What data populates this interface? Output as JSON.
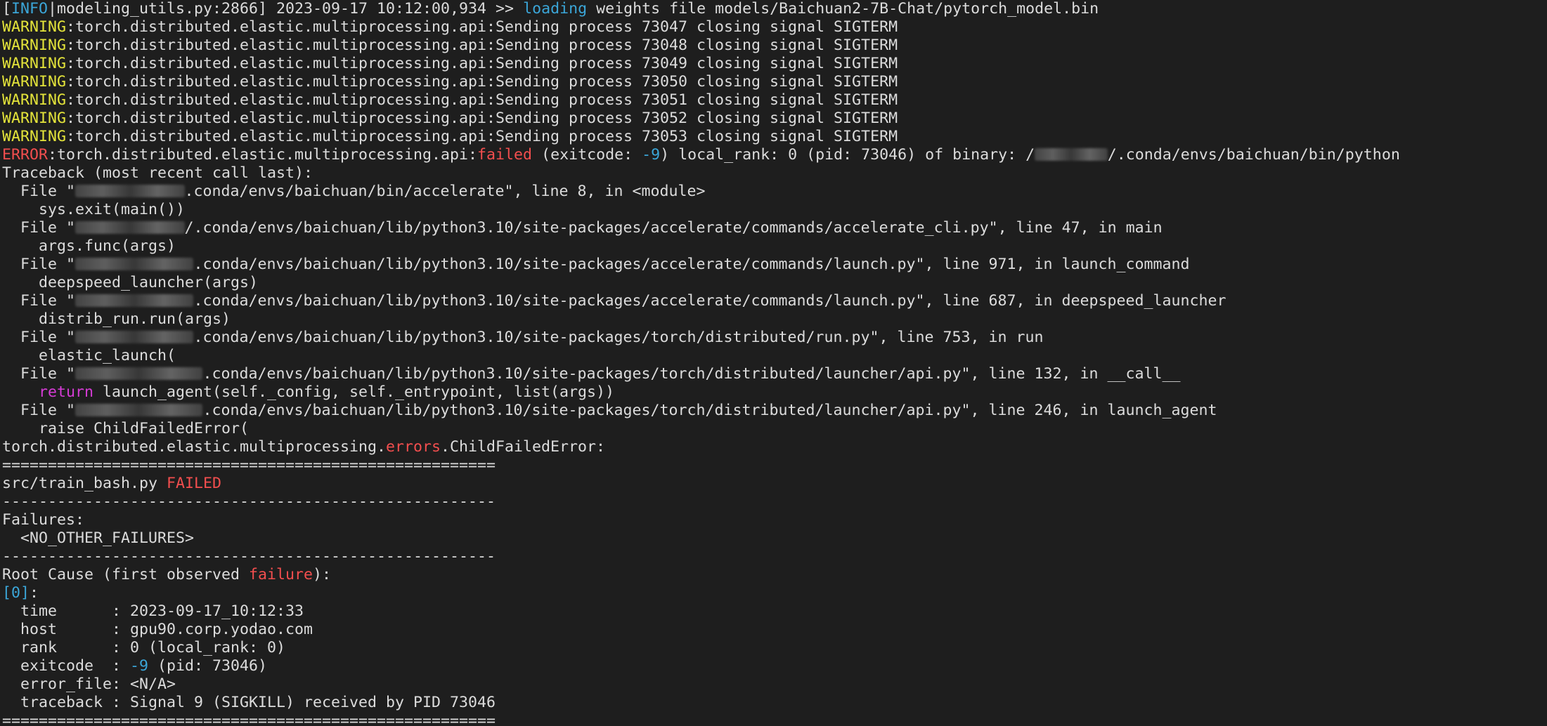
{
  "colors": {
    "background": "#1e1e1e",
    "text": "#dcdcdc",
    "cyan": "#3ba6d8",
    "yellow": "#e3e33a",
    "red": "#f24e4e",
    "magenta": "#d63cd6"
  },
  "terminal_lines": [
    [
      {
        "c": "white",
        "t": "["
      },
      {
        "c": "cyan",
        "t": "INFO"
      },
      {
        "c": "white",
        "t": "|modeling_utils.py:2866] 2023-09-17 10:12:00,934 >> "
      },
      {
        "c": "cyan",
        "t": "loading"
      },
      {
        "c": "white",
        "t": " weights file models/Baichuan2-7B-Chat/pytorch_model.bin"
      }
    ],
    [
      {
        "c": "yellow",
        "t": "WARNING"
      },
      {
        "c": "white",
        "t": ":torch.distributed.elastic.multiprocessing.api:Sending process 73047 closing signal SIGTERM"
      }
    ],
    [
      {
        "c": "yellow",
        "t": "WARNING"
      },
      {
        "c": "white",
        "t": ":torch.distributed.elastic.multiprocessing.api:Sending process 73048 closing signal SIGTERM"
      }
    ],
    [
      {
        "c": "yellow",
        "t": "WARNING"
      },
      {
        "c": "white",
        "t": ":torch.distributed.elastic.multiprocessing.api:Sending process 73049 closing signal SIGTERM"
      }
    ],
    [
      {
        "c": "yellow",
        "t": "WARNING"
      },
      {
        "c": "white",
        "t": ":torch.distributed.elastic.multiprocessing.api:Sending process 73050 closing signal SIGTERM"
      }
    ],
    [
      {
        "c": "yellow",
        "t": "WARNING"
      },
      {
        "c": "white",
        "t": ":torch.distributed.elastic.multiprocessing.api:Sending process 73051 closing signal SIGTERM"
      }
    ],
    [
      {
        "c": "yellow",
        "t": "WARNING"
      },
      {
        "c": "white",
        "t": ":torch.distributed.elastic.multiprocessing.api:Sending process 73052 closing signal SIGTERM"
      }
    ],
    [
      {
        "c": "yellow",
        "t": "WARNING"
      },
      {
        "c": "white",
        "t": ":torch.distributed.elastic.multiprocessing.api:Sending process 73053 closing signal SIGTERM"
      }
    ],
    [
      {
        "c": "red",
        "t": "ERROR"
      },
      {
        "c": "white",
        "t": ":torch.distributed.elastic.multiprocessing.api:"
      },
      {
        "c": "red",
        "t": "failed"
      },
      {
        "c": "white",
        "t": " (exitcode: "
      },
      {
        "c": "cyan",
        "t": "-9"
      },
      {
        "c": "white",
        "t": ") local_rank: 0 (pid: 73046) of binary: /"
      },
      {
        "c": "blur",
        "w": 8
      },
      {
        "c": "white",
        "t": "/.conda/envs/baichuan/bin/python"
      }
    ],
    [
      {
        "c": "white",
        "t": "Traceback (most recent call last):"
      }
    ],
    [
      {
        "c": "white",
        "t": "  File \""
      },
      {
        "c": "blur",
        "w": 12
      },
      {
        "c": "white",
        "t": ".conda/envs/baichuan/bin/accelerate\", line 8, in <module>"
      }
    ],
    [
      {
        "c": "white",
        "t": "    sys.exit(main())"
      }
    ],
    [
      {
        "c": "white",
        "t": "  File \""
      },
      {
        "c": "blur",
        "w": 12
      },
      {
        "c": "white",
        "t": "/.conda/envs/baichuan/lib/python3.10/site-packages/accelerate/commands/accelerate_cli.py\", line 47, in main"
      }
    ],
    [
      {
        "c": "white",
        "t": "    args.func(args)"
      }
    ],
    [
      {
        "c": "white",
        "t": "  File \""
      },
      {
        "c": "blur",
        "w": 13
      },
      {
        "c": "white",
        "t": ".conda/envs/baichuan/lib/python3.10/site-packages/accelerate/commands/launch.py\", line 971, in launch_command"
      }
    ],
    [
      {
        "c": "white",
        "t": "    deepspeed_launcher(args)"
      }
    ],
    [
      {
        "c": "white",
        "t": "  File \""
      },
      {
        "c": "blur",
        "w": 13
      },
      {
        "c": "white",
        "t": ".conda/envs/baichuan/lib/python3.10/site-packages/accelerate/commands/launch.py\", line 687, in deepspeed_launcher"
      }
    ],
    [
      {
        "c": "white",
        "t": "    distrib_run.run(args)"
      }
    ],
    [
      {
        "c": "white",
        "t": "  File \""
      },
      {
        "c": "blur",
        "w": 13
      },
      {
        "c": "white",
        "t": ".conda/envs/baichuan/lib/python3.10/site-packages/torch/distributed/run.py\", line 753, in run"
      }
    ],
    [
      {
        "c": "white",
        "t": "    elastic_launch("
      }
    ],
    [
      {
        "c": "white",
        "t": "  File \""
      },
      {
        "c": "blur",
        "w": 14
      },
      {
        "c": "white",
        "t": ".conda/envs/baichuan/lib/python3.10/site-packages/torch/distributed/launcher/api.py\", line 132, in __call__"
      }
    ],
    [
      {
        "c": "white",
        "t": "    "
      },
      {
        "c": "magenta",
        "t": "return"
      },
      {
        "c": "white",
        "t": " launch_agent(self._config, self._entrypoint, list(args))"
      }
    ],
    [
      {
        "c": "white",
        "t": "  File \""
      },
      {
        "c": "blur",
        "w": 14
      },
      {
        "c": "white",
        "t": ".conda/envs/baichuan/lib/python3.10/site-packages/torch/distributed/launcher/api.py\", line 246, in launch_agent"
      }
    ],
    [
      {
        "c": "white",
        "t": "    raise ChildFailedError("
      }
    ],
    [
      {
        "c": "white",
        "t": "torch.distributed.elastic.multiprocessing."
      },
      {
        "c": "red",
        "t": "errors"
      },
      {
        "c": "white",
        "t": ".ChildFailedError:"
      }
    ],
    [
      {
        "c": "white",
        "t": "======================================================"
      }
    ],
    [
      {
        "c": "white",
        "t": "src/train_bash.py "
      },
      {
        "c": "red",
        "t": "FAILED"
      }
    ],
    [
      {
        "c": "white",
        "t": "------------------------------------------------------"
      }
    ],
    [
      {
        "c": "white",
        "t": "Failures:"
      }
    ],
    [
      {
        "c": "white",
        "t": "  <NO_OTHER_FAILURES>"
      }
    ],
    [
      {
        "c": "white",
        "t": "------------------------------------------------------"
      }
    ],
    [
      {
        "c": "white",
        "t": "Root Cause (first observed "
      },
      {
        "c": "red",
        "t": "failure"
      },
      {
        "c": "white",
        "t": "):"
      }
    ],
    [
      {
        "c": "cyan",
        "t": "[0]"
      },
      {
        "c": "white",
        "t": ":"
      }
    ],
    [
      {
        "c": "white",
        "t": "  time      : 2023-09-17_10:12:33"
      }
    ],
    [
      {
        "c": "white",
        "t": "  host      : gpu90.corp.yodao.com"
      }
    ],
    [
      {
        "c": "white",
        "t": "  rank      : 0 (local_rank: 0)"
      }
    ],
    [
      {
        "c": "white",
        "t": "  exitcode  : "
      },
      {
        "c": "cyan",
        "t": "-9"
      },
      {
        "c": "white",
        "t": " (pid: 73046)"
      }
    ],
    [
      {
        "c": "white",
        "t": "  error_file: <N/A>"
      }
    ],
    [
      {
        "c": "white",
        "t": "  traceback : Signal 9 (SIGKILL) received by PID 73046"
      }
    ],
    [
      {
        "c": "white",
        "t": "======================================================"
      }
    ]
  ]
}
